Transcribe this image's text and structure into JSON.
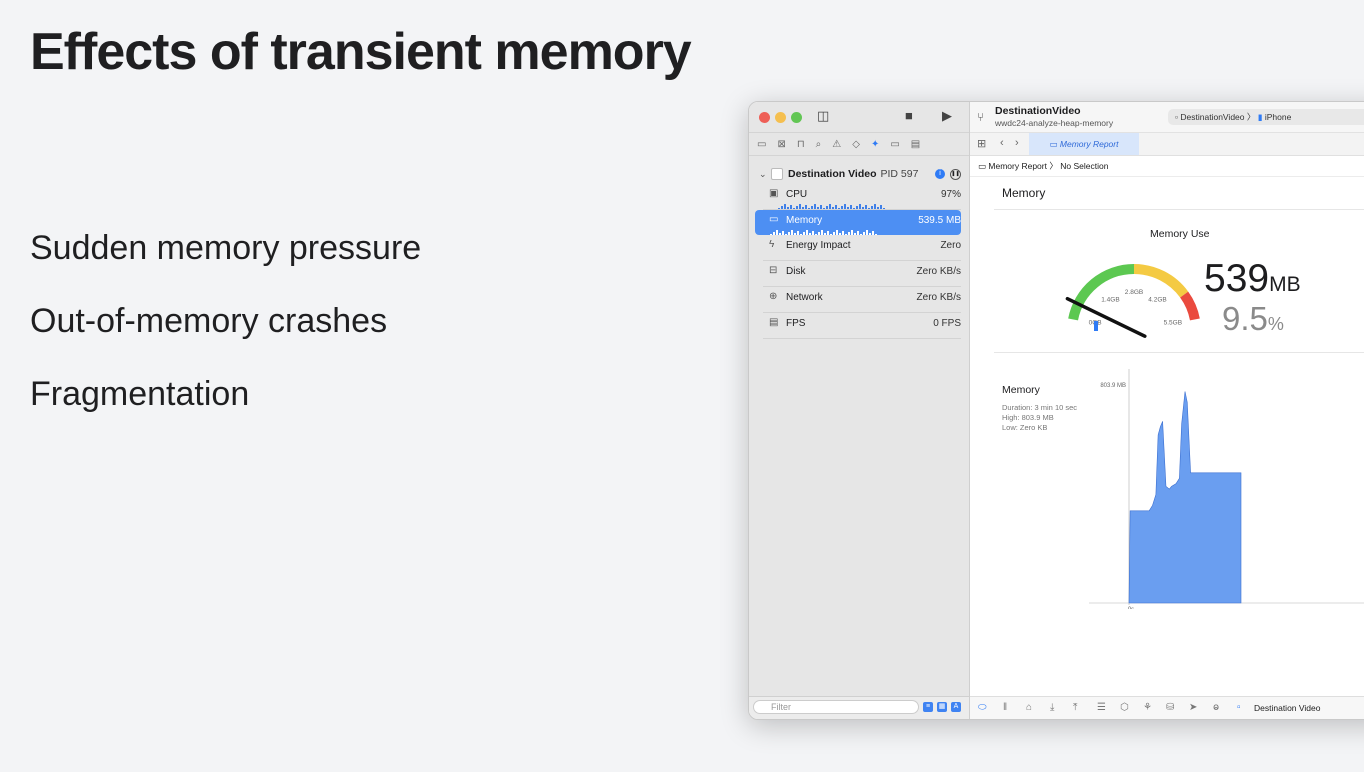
{
  "slide": {
    "title": "Effects of transient memory",
    "bullets": [
      "Sudden memory pressure",
      "Out-of-memory crashes",
      "Fragmentation"
    ]
  },
  "window": {
    "project_name": "DestinationVideo",
    "branch_name": "wwdc24-analyze-heap-memory",
    "scheme_target": "DestinationVideo",
    "scheme_device": "iPhone",
    "tab_label": "Memory Report",
    "jump_path": [
      "Memory Report",
      "No Selection"
    ]
  },
  "navigator": {
    "process_name": "Destination Video",
    "pid_label": "PID 597",
    "gauges": [
      {
        "label": "CPU",
        "value": "97%",
        "icon": "cpu-icon"
      },
      {
        "label": "Memory",
        "value": "539.5 MB",
        "icon": "memory-icon",
        "selected": true
      },
      {
        "label": "Energy Impact",
        "value": "Zero",
        "icon": "bolt-icon"
      },
      {
        "label": "Disk",
        "value": "Zero KB/s",
        "icon": "disk-icon"
      },
      {
        "label": "Network",
        "value": "Zero KB/s",
        "icon": "globe-icon"
      },
      {
        "label": "FPS",
        "value": "0 FPS",
        "icon": "film-icon"
      }
    ],
    "filter_placeholder": "Filter"
  },
  "report": {
    "section_title": "Memory",
    "gauge_title": "Memory Use",
    "gauge_ticks": [
      "0GB",
      "1.4GB",
      "2.8GB",
      "4.2GB",
      "5.5GB"
    ],
    "gauge_fraction": 0.095,
    "memory_value": "539",
    "memory_unit": "MB",
    "percent_value": "9.5",
    "percent_unit": "%",
    "graph": {
      "label": "Memory",
      "duration": "Duration: 3 min 10 sec",
      "high": "High: 803.9 MB",
      "low": "Low: Zero KB",
      "max_label": "803.9 MB",
      "origin_label": "0s"
    }
  },
  "debug_bar": {
    "target_label": "Destination Video"
  },
  "colors": {
    "accent": "#2f7bf5",
    "selection": "#4d8ff3",
    "gauge_green": "#5cc851",
    "gauge_yellow": "#f4ca43",
    "gauge_red": "#ea4a3e",
    "graph_fill": "#6a9ef0"
  },
  "chart_data": {
    "type": "area",
    "title": "",
    "ylabel": "",
    "ylim": [
      0,
      803.9
    ],
    "series": [
      {
        "name": "",
        "x_fraction": [
          0,
          0.01,
          0.02,
          0.18,
          0.21,
          0.24,
          0.26,
          0.28,
          0.3,
          0.33,
          0.36,
          0.38,
          0.42,
          0.45,
          0.47,
          0.5,
          0.52,
          0.55,
          0.56,
          0.58,
          1.0
        ],
        "values": [
          0,
          340,
          340,
          340,
          360,
          400,
          620,
          650,
          670,
          430,
          420,
          430,
          440,
          460,
          660,
          780,
          740,
          480,
          480,
          480,
          480
        ]
      }
    ]
  }
}
